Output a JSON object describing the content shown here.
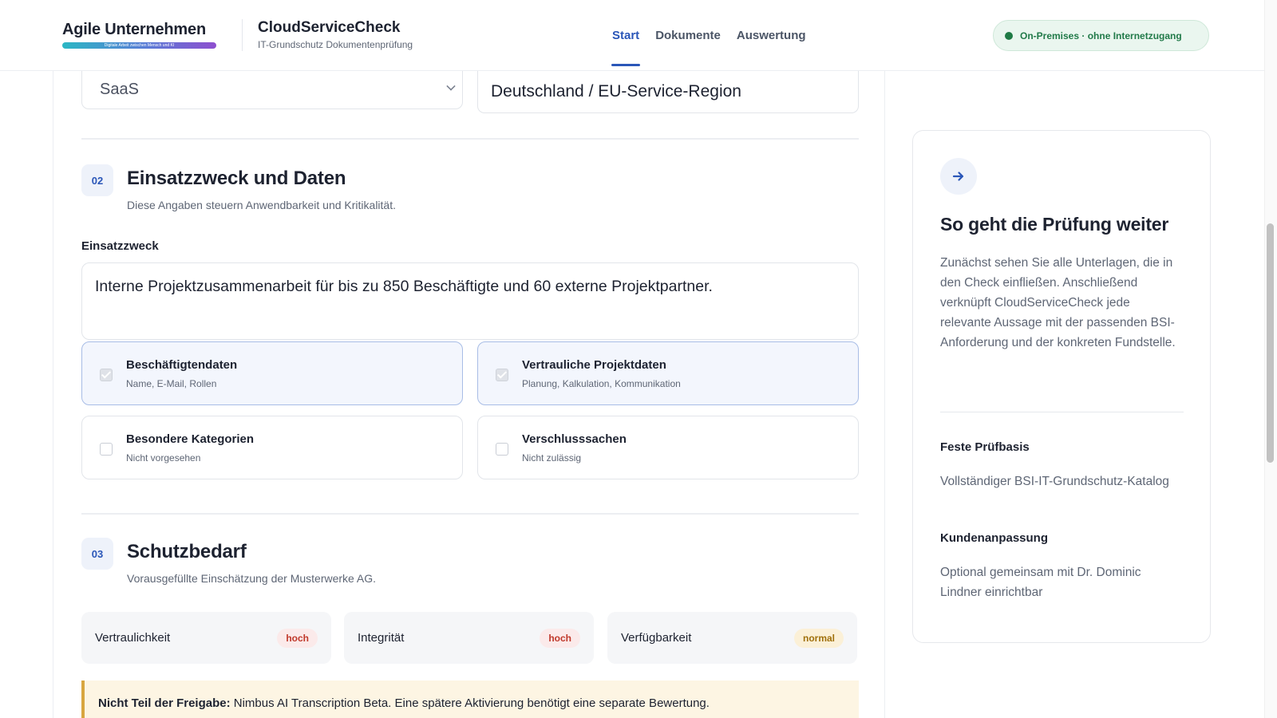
{
  "header": {
    "brand": "Agile Unternehmen",
    "brand_tagline": "Digitale Arbeit zwischen Mensch und KI",
    "app_name": "CloudServiceCheck",
    "app_subtitle": "IT-Grundschutz Dokumentenprüfung",
    "nav": [
      {
        "label": "Start",
        "active": true
      },
      {
        "label": "Dokumente",
        "active": false
      },
      {
        "label": "Auswertung",
        "active": false
      }
    ],
    "status": "On-Premises · ohne Internetzugang"
  },
  "form": {
    "service_model": "SaaS",
    "region": "Deutschland / EU-Service-Region"
  },
  "section_02": {
    "number": "02",
    "title": "Einsatzzweck und Daten",
    "subtitle": "Diese Angaben steuern Anwendbarkeit und Kritikalität.",
    "field_label": "Einsatzzweck",
    "field_value": "Interne Projektzusammenarbeit für bis zu 850 Beschäftigte und 60 externe Projektpartner.",
    "options": [
      {
        "title": "Beschäftigtendaten",
        "sub": "Name, E-Mail, Rollen",
        "checked": true
      },
      {
        "title": "Vertrauliche Projektdaten",
        "sub": "Planung, Kalkulation, Kommunikation",
        "checked": true
      },
      {
        "title": "Besondere Kategorien",
        "sub": "Nicht vorgesehen",
        "checked": false
      },
      {
        "title": "Verschlusssachen",
        "sub": "Nicht zulässig",
        "checked": false
      }
    ]
  },
  "section_03": {
    "number": "03",
    "title": "Schutzbedarf",
    "subtitle": "Vorausgefüllte Einschätzung der Musterwerke AG.",
    "items": [
      {
        "label": "Vertraulichkeit",
        "level": "hoch"
      },
      {
        "label": "Integrität",
        "level": "hoch"
      },
      {
        "label": "Verfügbarkeit",
        "level": "normal"
      }
    ]
  },
  "note": {
    "strong": "Nicht Teil der Freigabe:",
    "text": " Nimbus AI Transcription Beta. Eine spätere Aktivierung benötigt eine separate Bewertung."
  },
  "side": {
    "title": "So geht die Prüfung weiter",
    "text": "Zunächst sehen Sie alle Unterlagen, die in den Check einfließen. Anschließend verknüpft CloudServiceCheck jede relevante Aussage mit der passenden BSI-Anforderung und der konkreten Fundstelle.",
    "basis_label": "Feste Prüfbasis",
    "basis_value": "Vollständiger BSI-IT-Grundschutz-Katalog",
    "custom_label": "Kundenanpassung",
    "custom_value": "Optional gemeinsam mit Dr. Dominic Lindner einrichtbar"
  },
  "colors": {
    "accent": "#2a56b8",
    "status_green": "#217a49",
    "high": "#c0392b",
    "normal": "#a0700b"
  }
}
